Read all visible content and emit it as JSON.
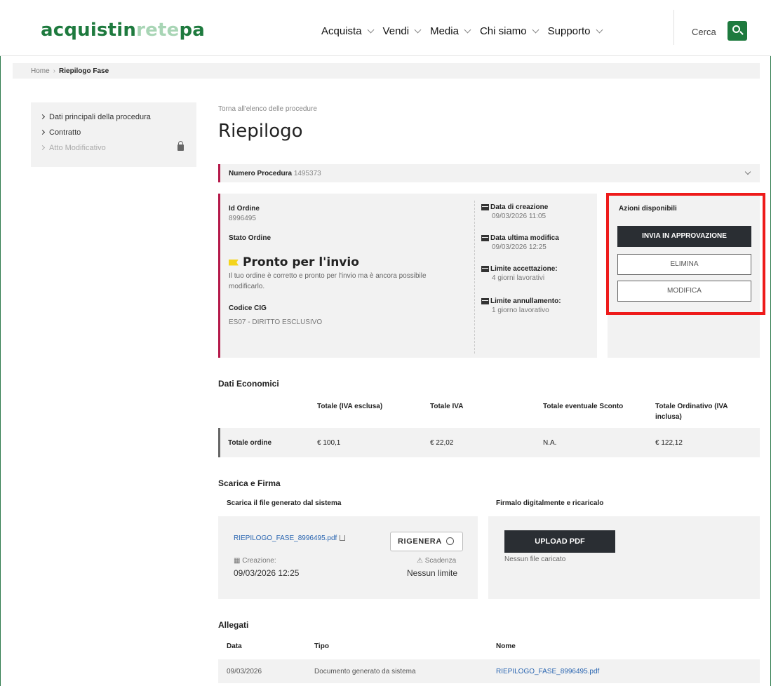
{
  "header": {
    "logo_part1": "acquistin",
    "logo_part2": "rete",
    "logo_part3": "pa",
    "nav": [
      "Acquista",
      "Vendi",
      "Media",
      "Chi siamo",
      "Supporto"
    ],
    "search_label": "Cerca",
    "brand_color": "#1e7a3e"
  },
  "breadcrumb": {
    "home": "Home",
    "current": "Riepilogo Fase"
  },
  "sidebar": {
    "items": [
      {
        "label": "Dati principali della procedura"
      },
      {
        "label": "Contratto"
      },
      {
        "label": "Atto Modificativo"
      }
    ]
  },
  "main": {
    "back_link": "Torna all'elenco delle procedure",
    "title": "Riepilogo",
    "procedure_label": "Numero Procedura",
    "procedure_number": "1495373",
    "order": {
      "id_label": "Id Ordine",
      "id_value": "8996495",
      "status_label": "Stato Ordine",
      "status_value": "Pronto per l'invio",
      "status_desc": "Il tuo ordine è corretto e pronto per l'invio ma è ancora possibile modificarlo.",
      "cig_label": "Codice CIG",
      "cig_value": "ES07 - DIRITTO ESCLUSIVO",
      "dates": [
        {
          "label": "Data di creazione",
          "value": "09/03/2026 11:05"
        },
        {
          "label": "Data ultima modifica",
          "value": "09/03/2026 12:25"
        },
        {
          "label": "Limite accettazione:",
          "value": "4 giorni lavorativi"
        },
        {
          "label": "Limite annullamento:",
          "value": "1 giorno lavorativo"
        }
      ]
    },
    "actions": {
      "title": "Azioni disponibili",
      "send": "INVIA IN APPROVAZIONE",
      "delete": "ELIMINA",
      "edit": "MODIFICA",
      "highlight_color": "#ee1b1b"
    },
    "economics": {
      "title": "Dati Economici",
      "headers": [
        "Totale (IVA esclusa)",
        "Totale IVA",
        "Totale eventuale Sconto",
        "Totale Ordinativo (IVA inclusa)"
      ],
      "row_label": "Totale ordine",
      "row_values": [
        "€ 100,1",
        "€ 22,02",
        "N.A.",
        "€ 122,12"
      ]
    },
    "sign": {
      "title": "Scarica e Firma",
      "download_title": "Scarica il file generato dal sistema",
      "upload_title": "Firmalo digitalmente e ricaricalo",
      "file_name": "RIEPILOGO_FASE_8996495.pdf",
      "regen": "RIGENERA",
      "creation_label": "Creazione:",
      "creation_value": "09/03/2026 12:25",
      "expiry_label": "Scadenza",
      "expiry_value": "Nessun limite",
      "upload_btn": "UPLOAD PDF",
      "no_file": "Nessun file caricato"
    },
    "attachments": {
      "title": "Allegati",
      "headers": [
        "Data",
        "Tipo",
        "Nome"
      ],
      "rows": [
        {
          "date": "09/03/2026",
          "type": "Documento generato da sistema",
          "name": "RIEPILOGO_FASE_8996495.pdf"
        }
      ]
    }
  }
}
